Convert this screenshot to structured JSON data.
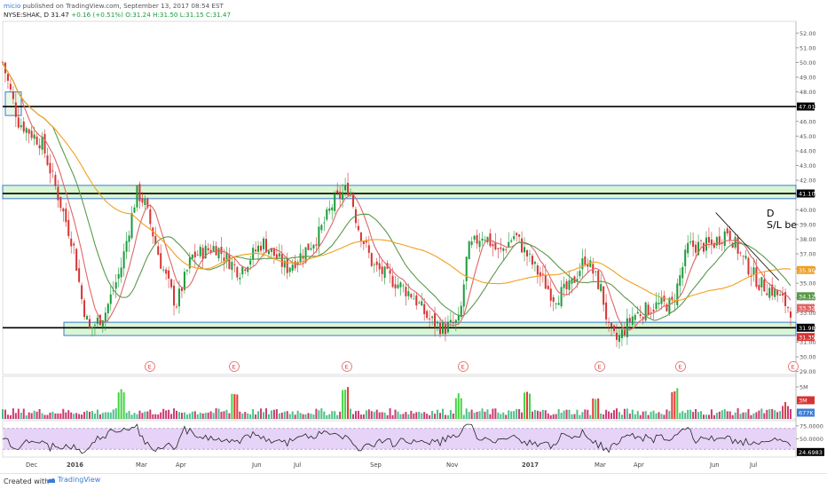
{
  "header": {
    "user": "micio",
    "published": "published on TradingView.com, September 13, 2017 08:54 EST",
    "symbol": "NYSE:SHAK, D",
    "last": "31.47",
    "change": "+0.16 (+0.51%)",
    "ohlc": "O:31.24 H:31.50 L:31.15 C:31.47"
  },
  "footer": {
    "created_with": "Created with",
    "brand": "TradingView"
  },
  "colors": {
    "up": "#1a9b3a",
    "down": "#d63434",
    "ma_fast": "#e06666",
    "ma_mid": "#5a9a4a",
    "ma_slow": "#f0a020",
    "zone_fill": "#d9f5d3",
    "zone_border": "#3a7bd5",
    "rsi_band": "#e6d3f7",
    "axis_label_bg": "#000000"
  },
  "chart_data": {
    "type": "candlestick",
    "price_axis": {
      "ticks": [
        "52.00",
        "51.00",
        "50.00",
        "49.00",
        "48.00",
        "47.00",
        "46.00",
        "45.00",
        "44.00",
        "43.00",
        "42.00",
        "41.00",
        "40.00",
        "39.00",
        "38.00",
        "37.00",
        "36.00",
        "35.00",
        "34.00",
        "33.00",
        "32.00",
        "31.00",
        "30.00",
        "29.00"
      ],
      "range": [
        28.8,
        52.8
      ]
    },
    "time_axis": {
      "labels": [
        "Dec",
        "2016",
        "Mar",
        "Apr",
        "Jun",
        "Jul",
        "Sep",
        "Nov",
        "2017",
        "Mar",
        "Apr",
        "Jun",
        "Jul"
      ],
      "bold": [
        "2016",
        "2017"
      ]
    },
    "horizontal_lines": [
      {
        "price": 47.01,
        "label": "47.01"
      },
      {
        "price": 41.1,
        "label": "41.10"
      },
      {
        "price": 31.98,
        "label": "31.98"
      }
    ],
    "zones": [
      {
        "from": 40.75,
        "to": 41.65
      },
      {
        "from": 31.45,
        "to": 32.35
      }
    ],
    "price_labels": [
      {
        "value": "35.90",
        "color": "#f0a020"
      },
      {
        "value": "34.12",
        "color": "#5a9a4a"
      },
      {
        "value": "33.32",
        "color": "#e06666"
      },
      {
        "value": "31.35",
        "color": "#d63434"
      }
    ],
    "annotation_lines": [
      "D",
      "S/L be"
    ],
    "trend_line": {
      "from": [
        "Jun",
        39.8
      ],
      "to": [
        "Jul",
        35.2
      ]
    },
    "earnings_marker": "E",
    "earnings_count": 7,
    "price_path": [
      [
        0,
        50.0
      ],
      [
        0.02,
        46.0
      ],
      [
        0.05,
        44.5
      ],
      [
        0.07,
        41.0
      ],
      [
        0.09,
        37.5
      ],
      [
        0.1,
        34.0
      ],
      [
        0.11,
        31.8
      ],
      [
        0.13,
        33.0
      ],
      [
        0.15,
        36.0
      ],
      [
        0.17,
        41.2
      ],
      [
        0.18,
        40.5
      ],
      [
        0.2,
        36.5
      ],
      [
        0.22,
        33.5
      ],
      [
        0.24,
        36.8
      ],
      [
        0.27,
        37.5
      ],
      [
        0.3,
        35.8
      ],
      [
        0.33,
        37.8
      ],
      [
        0.36,
        36.0
      ],
      [
        0.38,
        37.0
      ],
      [
        0.4,
        38.2
      ],
      [
        0.42,
        40.5
      ],
      [
        0.44,
        41.6
      ],
      [
        0.45,
        39.0
      ],
      [
        0.47,
        36.2
      ],
      [
        0.5,
        35.0
      ],
      [
        0.52,
        34.2
      ],
      [
        0.54,
        32.6
      ],
      [
        0.56,
        31.9
      ],
      [
        0.58,
        32.4
      ],
      [
        0.59,
        37.2
      ],
      [
        0.61,
        38.4
      ],
      [
        0.63,
        37.0
      ],
      [
        0.65,
        38.3
      ],
      [
        0.67,
        36.5
      ],
      [
        0.7,
        34.0
      ],
      [
        0.72,
        34.7
      ],
      [
        0.74,
        36.8
      ],
      [
        0.76,
        34.5
      ],
      [
        0.77,
        31.6
      ],
      [
        0.78,
        31.1
      ],
      [
        0.8,
        32.8
      ],
      [
        0.83,
        33.5
      ],
      [
        0.85,
        33.6
      ],
      [
        0.87,
        37.5
      ],
      [
        0.9,
        37.6
      ],
      [
        0.92,
        38.6
      ],
      [
        0.94,
        36.6
      ],
      [
        0.96,
        35.0
      ],
      [
        0.98,
        34.4
      ],
      [
        1,
        33.2
      ]
    ],
    "volume_axis": {
      "ticks": [
        "5M"
      ],
      "labels": [
        {
          "value": "3M",
          "color": "#d63434"
        },
        {
          "value": "677K",
          "color": "#3a7bd5"
        }
      ]
    },
    "rsi_axis": {
      "ticks": [
        "75.0000",
        "50.0000"
      ],
      "current": "24.6983",
      "band": [
        30,
        70
      ],
      "range": [
        15,
        85
      ]
    }
  }
}
